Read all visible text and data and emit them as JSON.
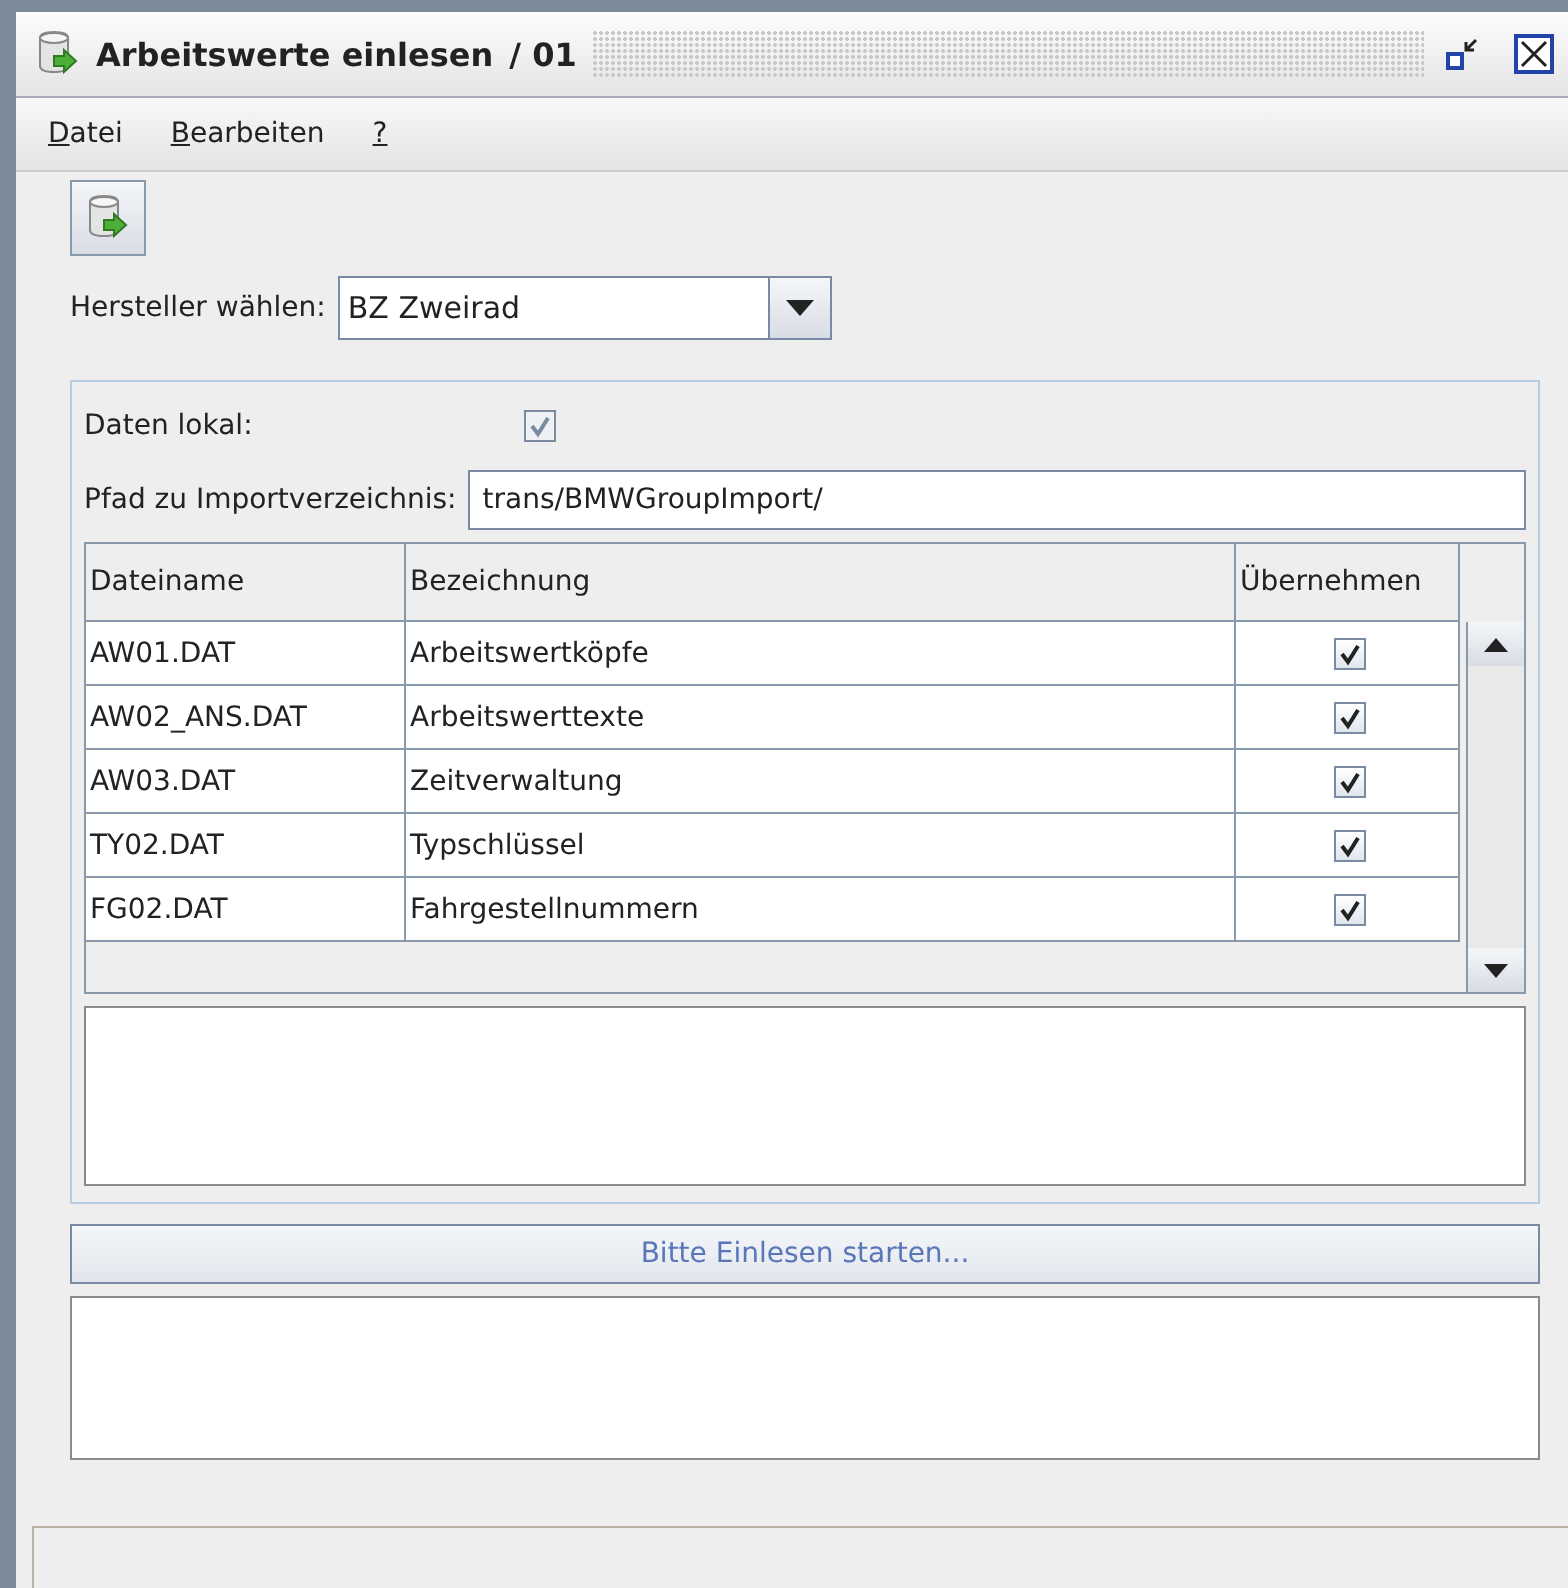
{
  "window": {
    "title": "Arbeitswerte einlesen",
    "number": "/ 01"
  },
  "menu": [
    {
      "mnemonic": "D",
      "rest": "atei"
    },
    {
      "mnemonic": "B",
      "rest": "earbeiten"
    },
    {
      "mnemonic": "?"
    }
  ],
  "manufacturer": {
    "label": "Hersteller wählen:",
    "value": "BZ Zweirad"
  },
  "local_data": {
    "label": "Daten lokal:",
    "checked": true,
    "disabled": true
  },
  "import_path": {
    "label": "Pfad zu Importverzeichnis:",
    "value": "trans/BMWGroupImport/"
  },
  "table": {
    "columns": [
      "Dateiname",
      "Bezeichnung",
      "Übernehmen"
    ],
    "rows": [
      {
        "file": "AW01.DAT",
        "description": "Arbeitswertköpfe",
        "checked": true
      },
      {
        "file": "AW02_ANS.DAT",
        "description": "Arbeitswerttexte",
        "checked": true
      },
      {
        "file": "AW03.DAT",
        "description": "Zeitverwaltung",
        "checked": true
      },
      {
        "file": "TY02.DAT",
        "description": "Typschlüssel",
        "checked": true
      },
      {
        "file": "FG02.DAT",
        "description": "Fahrgestellnummern",
        "checked": true
      }
    ]
  },
  "start_button": {
    "label": "Bitte Einlesen starten..."
  }
}
